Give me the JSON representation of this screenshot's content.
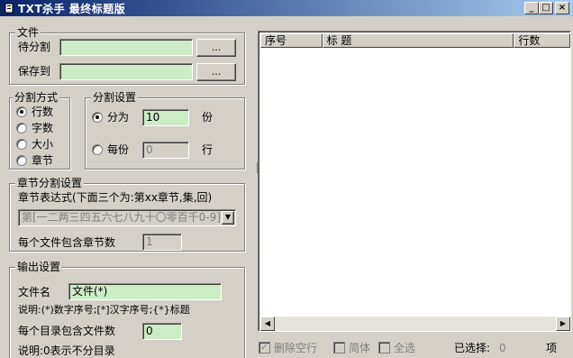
{
  "window": {
    "title": "TXT杀手  最终标题版",
    "controls": {
      "minimize": "_",
      "maximize": "□",
      "close": "×"
    }
  },
  "file_group": {
    "title": "文件",
    "source_label": "待分割",
    "source_value": "",
    "dest_label": "保存到",
    "dest_value": "",
    "browse_label": "...",
    "browse2_label": "..."
  },
  "split_mode": {
    "title": "分割方式",
    "options": [
      "行数",
      "字数",
      "大小",
      "章节"
    ],
    "selected": "行数"
  },
  "split_settings": {
    "title": "分割设置",
    "option1_label": "分为",
    "option1_value": "10",
    "option1_unit": "份",
    "option2_label": "每份",
    "option2_value": "0",
    "option2_unit": "行",
    "selected": "分为"
  },
  "chapter_settings": {
    "title": "章节分割设置",
    "expr_label": "章节表达式(下面三个为:第xx章节,集,回)",
    "expr_value": "第[一二两三四五六七八九十〇零百千0-9]",
    "chapters_label": "每个文件包含章节数",
    "chapters_value": "1"
  },
  "output_settings": {
    "title": "输出设置",
    "filename_label": "文件名",
    "filename_value": "文件(*)",
    "note1": "说明:(*)数字序号;[*]汉字序号;{*}标题",
    "dir_label": "每个目录包含文件数",
    "dir_value": "0",
    "note2": "说明:0表示不分目录"
  },
  "list": {
    "columns": [
      "序号",
      "标    题",
      "行数"
    ],
    "rows": []
  },
  "bottom_bar": {
    "delete_blank_label": "删除空行",
    "delete_blank_checked": true,
    "simplified_label": "简体",
    "simplified_checked": false,
    "select_all_label": "全选",
    "select_all_checked": false,
    "selected_label": "已选择:",
    "selected_count": "0",
    "unit_label": "项"
  },
  "icons": {
    "app": "app-icon",
    "radio": "radio-icon",
    "checkbox": "checkbox-icon",
    "dropdown": "chevron-down-icon",
    "scroll_left": "arrow-left-icon",
    "scroll_right": "arrow-right-icon"
  }
}
